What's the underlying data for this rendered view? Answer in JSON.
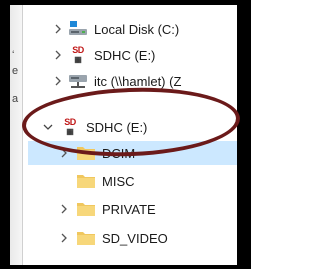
{
  "tree": {
    "items": [
      {
        "label": "Local Disk (C:)",
        "icon": "drive-icon",
        "state": "collapsed"
      },
      {
        "label": "SDHC (E:)",
        "icon": "sdhc-card-icon",
        "state": "collapsed"
      },
      {
        "label": "itc (\\\\hamlet) (Z",
        "icon": "network-drive-icon",
        "state": "collapsed"
      },
      {
        "label": "SDHC (E:)",
        "icon": "sdhc-card-icon",
        "state": "expanded"
      },
      {
        "label": "DCIM",
        "icon": "folder-icon",
        "state": "collapsed",
        "selected": true
      },
      {
        "label": "MISC",
        "icon": "folder-icon",
        "state": "none"
      },
      {
        "label": "PRIVATE",
        "icon": "folder-icon",
        "state": "collapsed"
      },
      {
        "label": "SD_VIDEO",
        "icon": "folder-icon",
        "state": "collapsed"
      }
    ],
    "sd_logo_text": "SD",
    "left_fragments": [
      "‘",
      "e",
      "a"
    ]
  },
  "colors": {
    "selection": "#cce8ff",
    "annotation_oval": "#6b1a1a",
    "folder": "#f0c75e"
  }
}
